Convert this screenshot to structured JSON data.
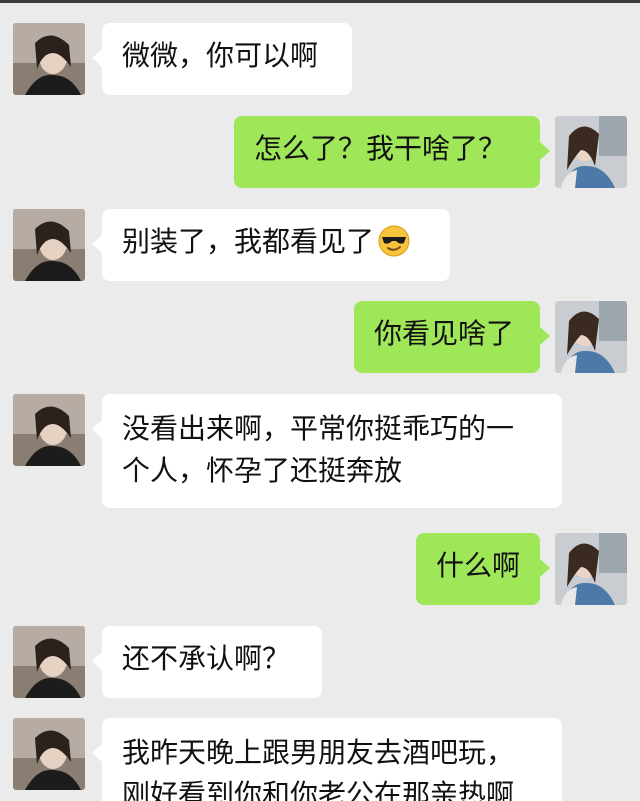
{
  "chat": {
    "messages": [
      {
        "side": "in",
        "text": "微微，你可以啊"
      },
      {
        "side": "out",
        "text": "怎么了？我干啥了？"
      },
      {
        "side": "in",
        "text": "别装了，我都看见了",
        "emoji": "sunglasses-emoji"
      },
      {
        "side": "out",
        "text": "你看见啥了"
      },
      {
        "side": "in",
        "lines": [
          "没看出来啊，平常你挺乖巧的一",
          "个人，怀孕了还挺奔放"
        ]
      },
      {
        "side": "out",
        "text": "什么啊"
      },
      {
        "side": "in",
        "text": "还不承认啊？"
      },
      {
        "side": "in",
        "lines": [
          "我昨天晚上跟男朋友去酒吧玩，",
          "刚好看到你和你老公在那亲热啊"
        ]
      }
    ]
  },
  "colors": {
    "background": "#ebebeb",
    "incoming_bubble": "#ffffff",
    "outgoing_bubble": "#9fe658"
  }
}
